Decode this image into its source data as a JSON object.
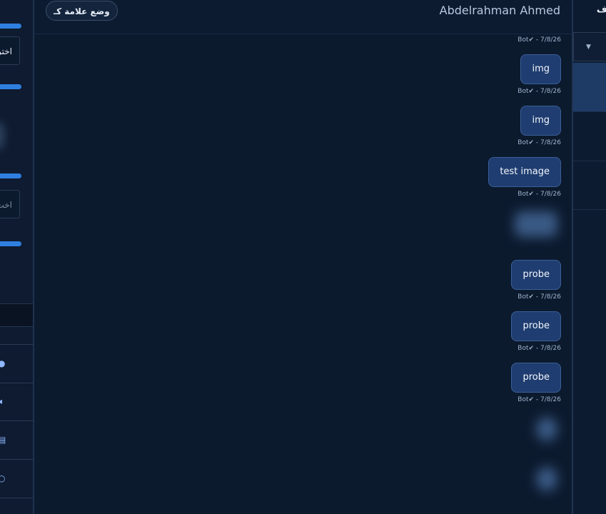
{
  "left_panel": {
    "field1_text": "اختر",
    "field2_placeholder": "اخت",
    "icons": [
      "check-circle-icon",
      "sound-icon",
      "calendar-icon",
      "clock-icon"
    ]
  },
  "chat": {
    "contact_name": "Abdelrahman Ahmed",
    "mark_button_label": "وضع علامة كـ",
    "messages": [
      {
        "meta": "Bot✔ - 7/8/26"
      },
      {
        "text": "img",
        "meta": "Bot✔ - 7/8/26"
      },
      {
        "text": "img",
        "meta": "Bot✔ - 7/8/26"
      },
      {
        "text": "test image",
        "meta": "Bot✔ - 7/8/26"
      },
      {
        "blurred": true
      },
      {
        "text": "probe",
        "meta": "Bot✔ - 7/8/26"
      },
      {
        "text": "probe",
        "meta": "Bot✔ - 7/8/26"
      },
      {
        "text": "probe",
        "meta": "Bot✔ - 7/8/26"
      },
      {
        "blurred": true
      },
      {
        "blurred": true
      }
    ]
  },
  "right_panel": {
    "header_text": "ف",
    "select_caret": "▼"
  },
  "colors": {
    "background": "#0c1a2e",
    "bubble": "#1f3d70",
    "accent": "#2f7fe0"
  }
}
